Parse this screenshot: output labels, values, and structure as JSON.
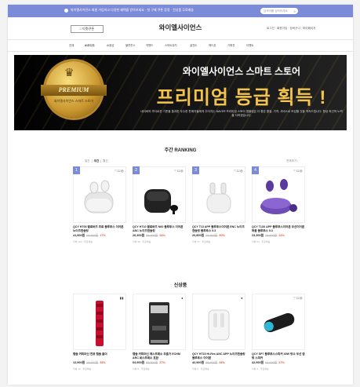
{
  "topbar": {
    "notice": "와이엘사이언스 회원 가입하고 다양한 혜택을 받아보세요 · 첫 구매 쿠폰 증정 · 전상품 무료배송",
    "search_placeholder": "검색어를 입력하세요"
  },
  "header": {
    "ticket": "□ 티켓/쿠폰",
    "logo": "와이엘사이언스",
    "util": "로그인 · 회원가입 · 장바구니 · 마이페이지"
  },
  "gnb": [
    "전체",
    "AI오디오",
    "AI음성",
    "블루투스",
    "넥밴드",
    "스마트워치",
    "골전도",
    "헤드폰",
    "기획전",
    "이벤트"
  ],
  "banner": {
    "badge_word": "PREMIUM",
    "badge_sub": "와이엘사이언스 스마트 스토어",
    "title": "와이엘사이언스 스마트 스토어",
    "headline": "프리미엄 등급 획득 !",
    "desc": "네이버의 까다로운 기준을 통과한 우수한 판매자들에게 주어지는 NAVER 프리미엄 스토어 엠블럼은 더 좋은 품질, 가격, 서비스로 보답할 것을 약속드립니다. 항상 최선의 노력을 다하겠습니다.",
    "slides": 6,
    "active_slide": 1
  },
  "ranking": {
    "title": "주간 RANKING",
    "tabs": [
      "일간",
      "주간",
      "월간"
    ],
    "active_tab": "주간",
    "more": "전체보기 ›",
    "items": [
      {
        "rank": "1",
        "name": "QCY HT05 멜로버즈 프로 블루투스 이어폰 노이즈캔슬링",
        "price": "41,900원",
        "orig": "49,900원",
        "discount": "17%",
        "meta": "리뷰 123 · 무료배송"
      },
      {
        "rank": "2",
        "name": "QCY HT10 멜로버즈 N60 블루투스 이어폰 ANC 노이즈캔슬링",
        "price": "26,300원",
        "orig": "39,900원",
        "discount": "34%",
        "meta": "리뷰 98 · 무료배송"
      },
      {
        "rank": "3",
        "name": "QCY T13 APP 블루투스이어폰 ENC 노이즈캔슬링 블루투스 5.3",
        "price": "20,800원",
        "orig": "29,900원",
        "discount": "30%",
        "meta": "리뷰 77 · 무료배송"
      },
      {
        "rank": "4",
        "name": "QCY T13X APP 블루투스이어폰 무선이어폰 퍼플 블루투스 5.3",
        "price": "23,300원",
        "orig": "29,900원",
        "discount": "22%",
        "meta": "리뷰 54 · 무료배송"
      }
    ]
  },
  "new": {
    "title": "신상품",
    "items": [
      {
        "name": "캡슐 커피머신 전용 캡슐 홀더",
        "price": "12,900원",
        "orig": "19,900원",
        "discount": "35%",
        "meta": "리뷰 12 · 무료배송"
      },
      {
        "name": "캡슐 커피머신 에스프레소 추출기 ECHM ARC 네스프레소 호환",
        "price": "64,900원",
        "orig": "89,000원",
        "discount": "27%",
        "meta": "리뷰 8 · 무료배송"
      },
      {
        "name": "QCY HT15 Hi-Res ANC APP 노이즈캔슬링 블루투스 이어폰",
        "price": "42,900원",
        "orig": "59,900원",
        "discount": "28%",
        "meta": "리뷰 5 · 무료배송"
      },
      {
        "name": "QCY SP7 블루투스스피커 40W 방수 무선 캠핑 스피커",
        "price": "42,900원",
        "orig": "59,000원",
        "discount": "27%",
        "meta": "리뷰 3 · 무료배송"
      }
    ]
  },
  "colors": {
    "accent": "#7c8bd8",
    "gold": "#f3c34e",
    "sale": "#e25c3c"
  }
}
